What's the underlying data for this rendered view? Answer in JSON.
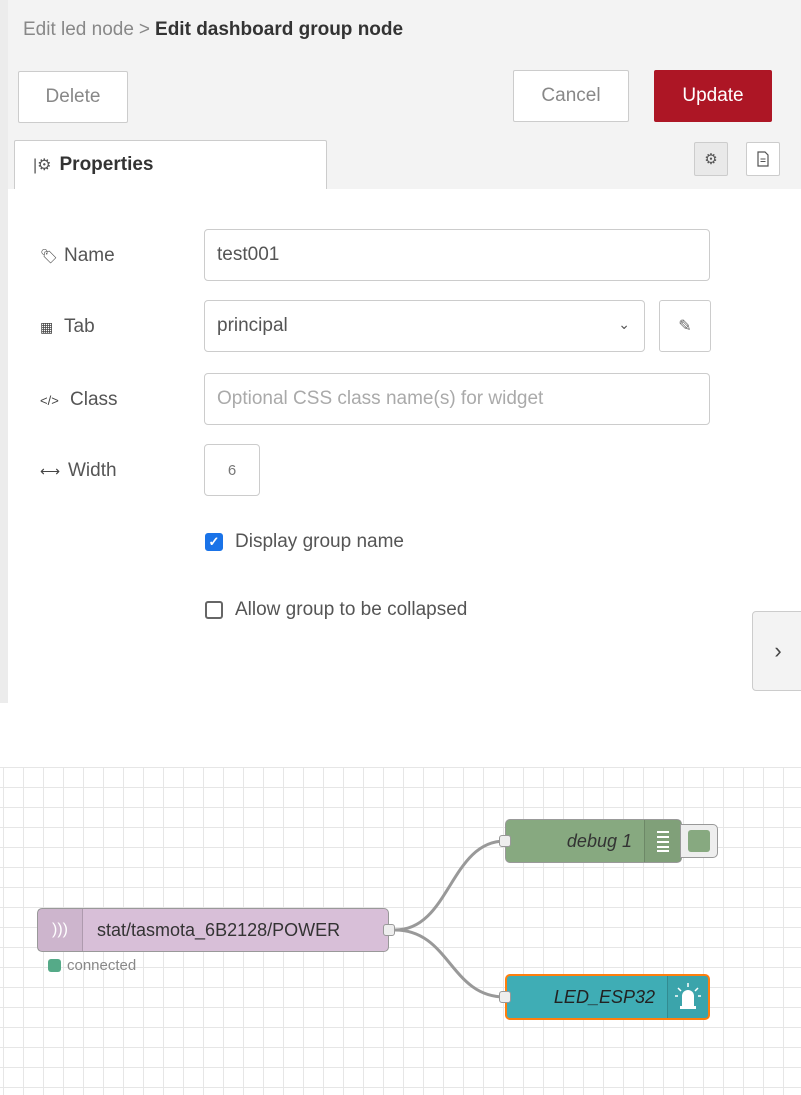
{
  "header": {
    "breadcrumb_parent": "Edit led node",
    "breadcrumb_separator": ">",
    "breadcrumb_current": "Edit dashboard group node"
  },
  "toolbar": {
    "delete_label": "Delete",
    "cancel_label": "Cancel",
    "update_label": "Update",
    "update_color": "#ad1625"
  },
  "tabs": {
    "properties_label": "Properties",
    "settings_icon": "gear-icon",
    "info_icon": "document-icon"
  },
  "form": {
    "name_label": "Name",
    "name_value": "test001",
    "tab_label": "Tab",
    "tab_value": "principal",
    "class_label": "Class",
    "class_placeholder": "Optional CSS class name(s) for widget",
    "width_label": "Width",
    "width_value": "6",
    "display_group_name_label": "Display group name",
    "display_group_name_checked": true,
    "allow_collapse_label": "Allow group to be collapsed",
    "allow_collapse_checked": false
  },
  "flow": {
    "mqtt_node_label": "stat/tasmota_6B2128/POWER",
    "mqtt_status": "connected",
    "debug_node_label": "debug 1",
    "led_node_label": "LED_ESP32",
    "mqtt_color": "#d8bfd8",
    "debug_color": "#87a980",
    "led_color": "#3fadb5"
  }
}
